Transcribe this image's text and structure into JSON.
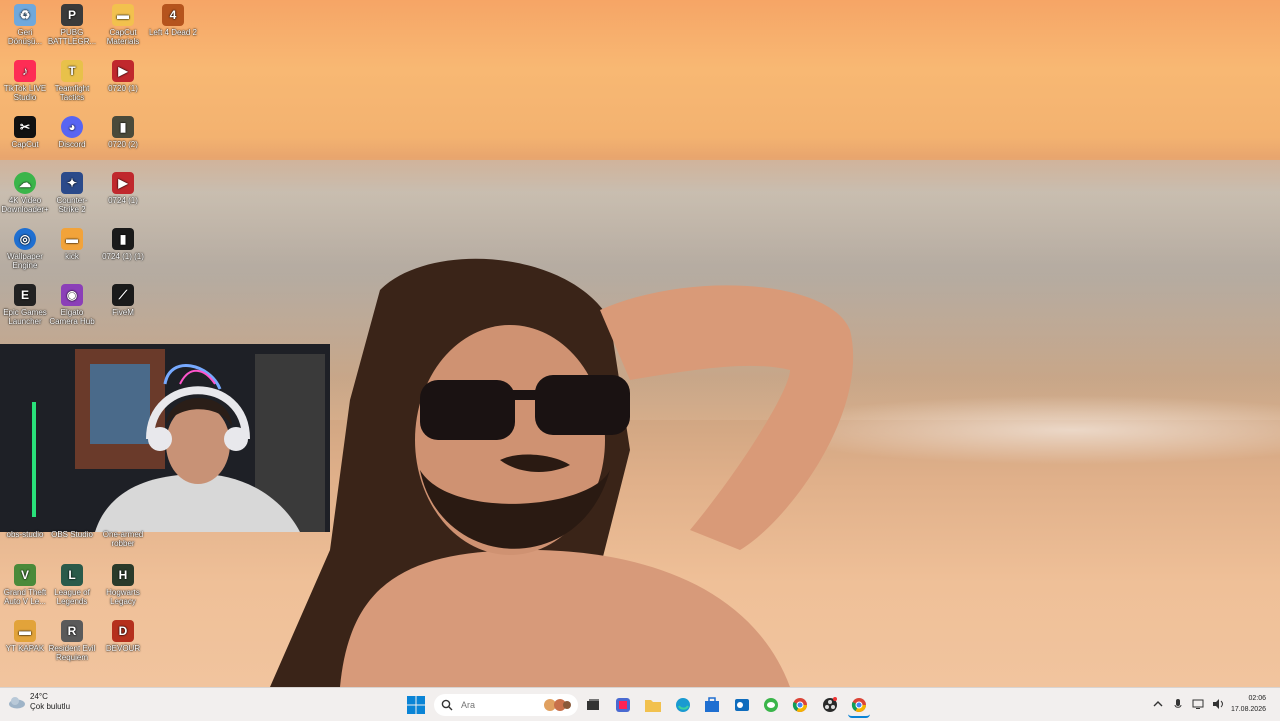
{
  "desktop_icons": [
    {
      "label": "Geri Dönüşü...",
      "color": "#6fa8dc"
    },
    {
      "label": "PUBG BATTLEGR...",
      "color": "#3a3a3a"
    },
    {
      "label": "CapCut Materials",
      "color": "#f2c14e"
    },
    {
      "label": "Left 4 Dead 2",
      "color": "#b5541d"
    },
    {
      "label": "TikTok LIVE Studio",
      "color": "#fe2c55"
    },
    {
      "label": "Teamfight Tactics",
      "color": "#e8c14a"
    },
    {
      "label": "0720 (1)",
      "color": "#c0282d"
    },
    {
      "label": "CapCut",
      "color": "#111111"
    },
    {
      "label": "Discord",
      "color": "#5865f2"
    },
    {
      "label": "0720 (2)",
      "color": "#4a4a3a"
    },
    {
      "label": "4K Video Downloader+",
      "color": "#3bb54a"
    },
    {
      "label": "Counter-Strike 2",
      "color": "#2b4a8a"
    },
    {
      "label": "0724 (1)",
      "color": "#c0282d"
    },
    {
      "label": "Wallpaper Engine",
      "color": "#1f6fd1"
    },
    {
      "label": "kick",
      "color": "#f2a33a"
    },
    {
      "label": "0724 (1) (1)",
      "color": "#1a1a1a"
    },
    {
      "label": "Epic Games Launcher",
      "color": "#222222"
    },
    {
      "label": "Elgato Camera Hub",
      "color": "#8b3fb8"
    },
    {
      "label": "FiveM",
      "color": "#1a1a1a"
    },
    {
      "label": "obs-studio",
      "color": "#333333"
    },
    {
      "label": "OBS Studio",
      "color": "#333333"
    },
    {
      "label": "One-armed robber",
      "color": "#7a2b6e"
    },
    {
      "label": "Grand Theft Auto V Le...",
      "color": "#4a8a3a"
    },
    {
      "label": "League of Legends",
      "color": "#2a5a4a"
    },
    {
      "label": "Hogwarts Legacy",
      "color": "#2a3a2a"
    },
    {
      "label": "YT KAPAK",
      "color": "#e2a33a"
    },
    {
      "label": "Resident Evil Requiem",
      "color": "#5a5a5a"
    },
    {
      "label": "DEVOUR",
      "color": "#b5301d"
    }
  ],
  "taskbar": {
    "weather_temp": "24°C",
    "weather_desc": "Çok bulutlu",
    "search_placeholder": "Ara",
    "time": "02:06",
    "date": "17.08.2026",
    "apps": [
      {
        "name": "file-manager",
        "color": "#333333"
      },
      {
        "name": "app-store-like",
        "color": "#4a6ad1"
      },
      {
        "name": "file-explorer",
        "color": "#f2c14e"
      },
      {
        "name": "edge",
        "color": "#1a9ad1"
      },
      {
        "name": "microsoft-store",
        "color": "#1f6fd1"
      },
      {
        "name": "outlook",
        "color": "#0f6cbd"
      },
      {
        "name": "xbox-like",
        "color": "#3bb54a"
      },
      {
        "name": "chrome",
        "color": "#db4437"
      },
      {
        "name": "obs",
        "color": "#2a2a2a"
      },
      {
        "name": "chrome-active",
        "color": "#db4437"
      }
    ]
  }
}
